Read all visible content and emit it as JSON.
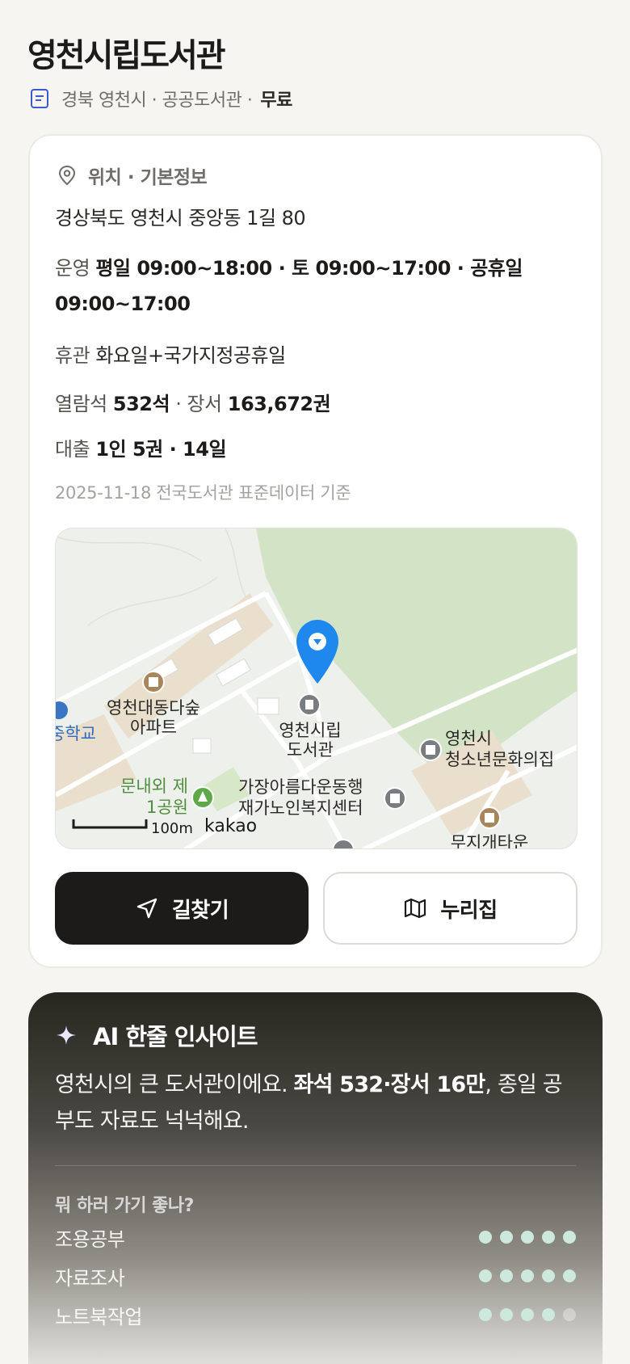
{
  "header": {
    "title": "영천시립도서관",
    "region": "경북 영천시 · 공공도서관 ·",
    "fee": "무료"
  },
  "info": {
    "section_title": "위치 · 기본정보",
    "address": "경상북도 영천시 중앙동 1길 80",
    "hours_label": "운영",
    "hours_value": "평일 09:00~18:00 · 토 09:00~17:00 · 공휴일 09:00~17:00",
    "closed_label": "휴관",
    "closed_value": "화요일+국가지정공휴일",
    "seats_label": "열람석",
    "seats_value": "532석",
    "books_label": "· 장서",
    "books_value": "163,672권",
    "loan_label": "대출",
    "loan_value": "1인 5권 · 14일",
    "basis": "2025-11-18 전국도서관 표준데이터 기준"
  },
  "map": {
    "labels": {
      "apartment": "영천대동다숲",
      "apartment2": "아파트",
      "school": "중학교",
      "library1": "영천시립",
      "library2": "도서관",
      "youth1": "영천시",
      "youth2": "청소년문화의집",
      "park1": "문내외 제",
      "park2": "1공원",
      "senior1": "가장아름다운동행",
      "senior2": "재가노인복지센터",
      "town": "무지개타운",
      "scale": "100m",
      "provider": "kakao"
    }
  },
  "actions": {
    "directions_label": "길찾기",
    "nurizip_label": "누리집"
  },
  "ai": {
    "title": "AI 한줄 인사이트",
    "text_pre": "영천시의 큰 도서관이에요. ",
    "text_bold": "좌석 532·장서 16만",
    "text_post": ", 종일 공부도 자료도 넉넉해요.",
    "question": "뭐 하러 가기 좋나?",
    "ratings": [
      {
        "label": "조용공부",
        "score": 5
      },
      {
        "label": "자료조사",
        "score": 5
      },
      {
        "label": "노트북작업",
        "score": 4
      }
    ],
    "accent_color": "#cde8dc"
  }
}
